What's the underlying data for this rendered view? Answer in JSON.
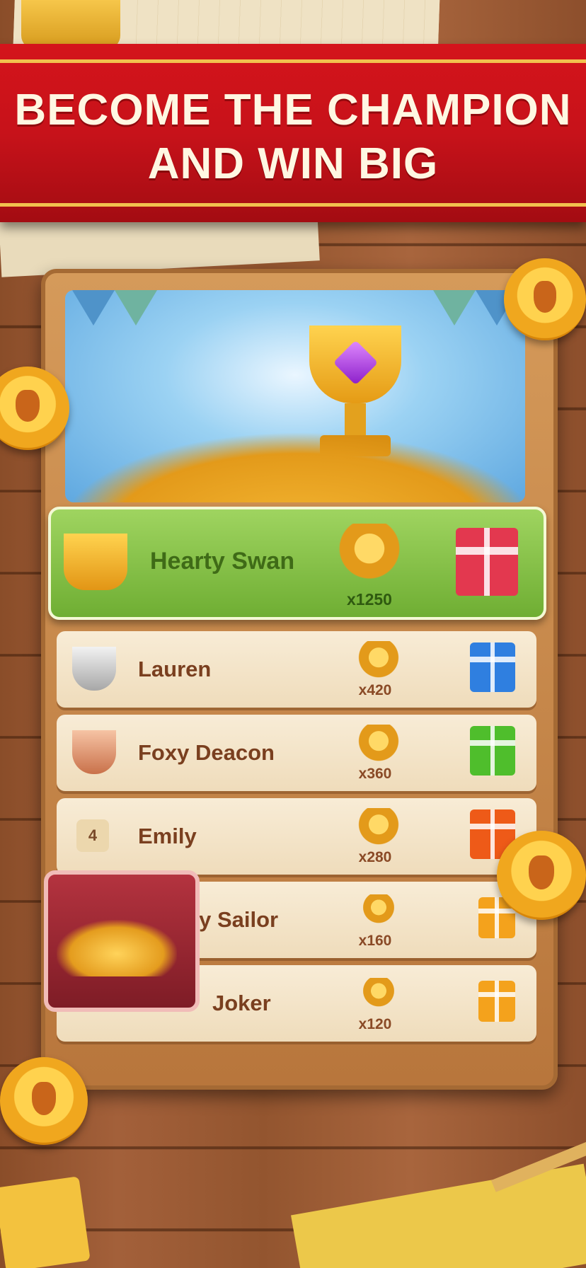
{
  "banner": {
    "line1": "BECOME THE CHAMPION",
    "line2": "AND WIN BIG"
  },
  "leaderboard": [
    {
      "rank_icon": "gold-trophy-icon",
      "name": "Hearty Swan",
      "reward": "x1250",
      "gift": "red-gift-icon",
      "color": "#e3384f"
    },
    {
      "rank_icon": "silver-trophy-icon",
      "name": "Lauren",
      "reward": "x420",
      "gift": "blue-gift-icon",
      "color": "#2f7fe0"
    },
    {
      "rank_icon": "bronze-trophy-icon",
      "name": "Foxy Deacon",
      "reward": "x360",
      "gift": "green-gift-icon",
      "color": "#4fbe2c"
    },
    {
      "rank": "4",
      "name": "Emily",
      "reward": "x280",
      "gift": "orange-gift-icon",
      "color": "#ee5a18"
    },
    {
      "name": "Sloppy Sailor",
      "reward": "x160",
      "gift": "yellow-gift-icon",
      "color": "#f4a21c"
    },
    {
      "name": "Joker",
      "reward": "x120",
      "gift": "yellow-gift-icon",
      "color": "#f4a21c"
    }
  ]
}
